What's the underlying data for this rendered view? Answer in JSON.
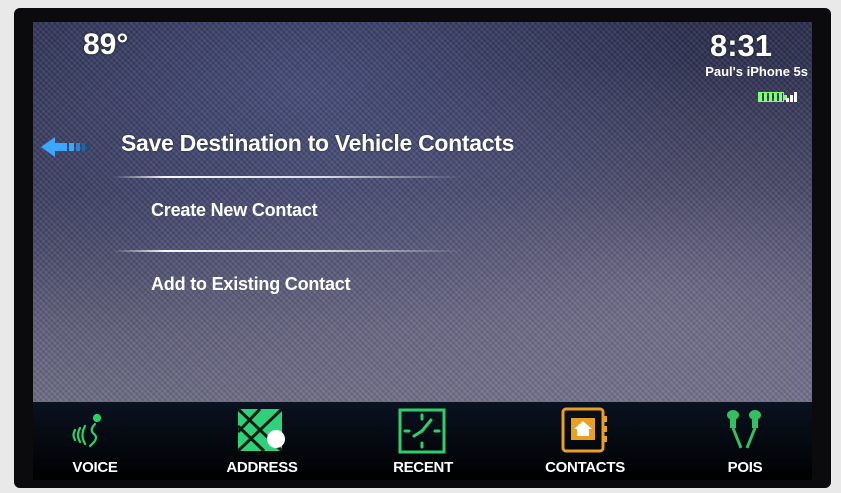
{
  "status_bar": {
    "temperature": "89°",
    "time": "8:31",
    "device_name": "Paul's iPhone 5s",
    "battery_color": "#7dff6e"
  },
  "header": {
    "back_icon": "back-arrow-icon",
    "title": "Save Destination to Vehicle Contacts"
  },
  "menu": {
    "items": [
      {
        "label": "Create New Contact"
      },
      {
        "label": "Add to Existing Contact"
      }
    ]
  },
  "bottom_nav": {
    "items": [
      {
        "label": "VOICE",
        "icon": "voice-icon",
        "color": "#22d46a"
      },
      {
        "label": "ADDRESS",
        "icon": "address-map-icon",
        "color": "#2fd07a"
      },
      {
        "label": "RECENT",
        "icon": "clock-icon",
        "color": "#2ccf6b"
      },
      {
        "label": "CONTACTS",
        "icon": "contacts-book-icon",
        "color": "#e8a01e"
      },
      {
        "label": "POIS",
        "icon": "pushpin-icon",
        "color": "#33c060"
      }
    ]
  },
  "colors": {
    "accent_blue": "#3aa8ff",
    "text": "#ffffff"
  }
}
